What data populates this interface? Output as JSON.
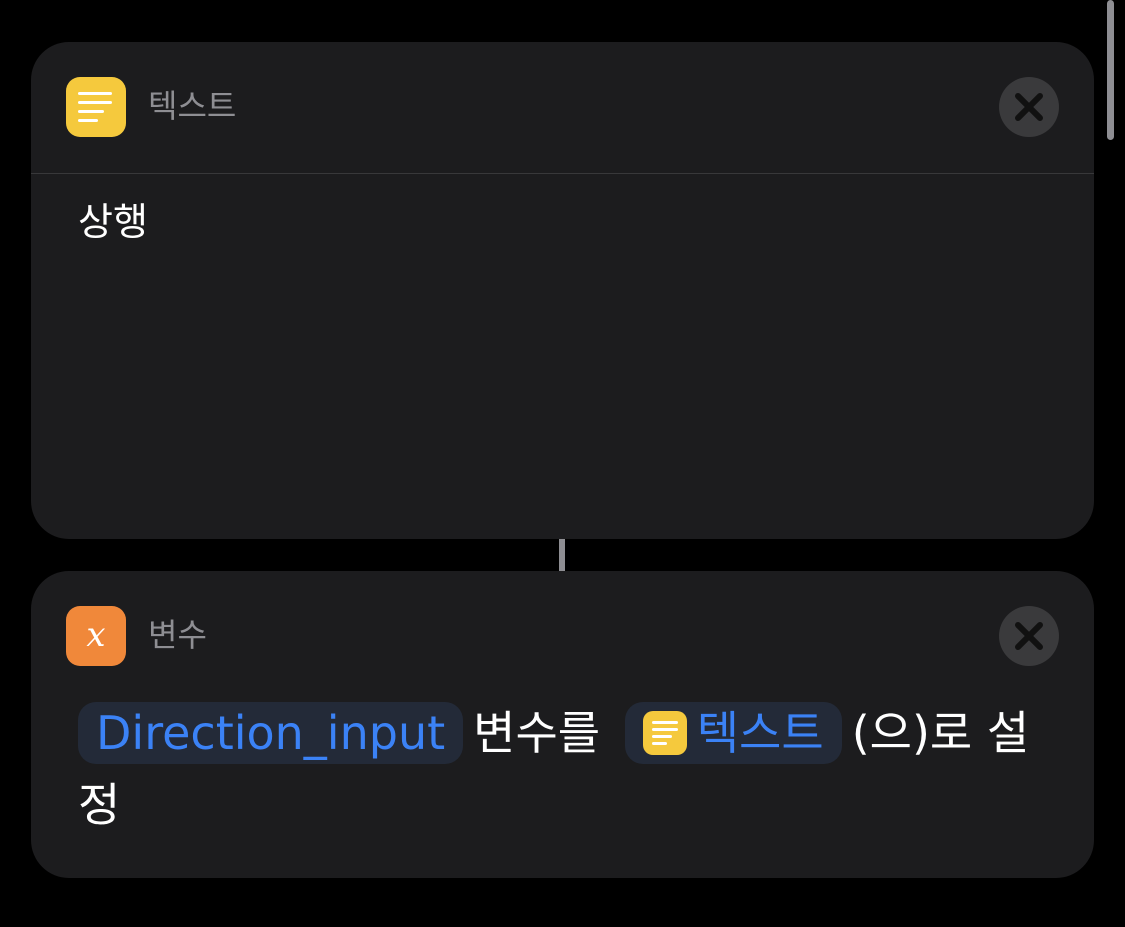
{
  "text_action": {
    "title": "텍스트",
    "icon": "text-lines-icon",
    "icon_color": "#f5c93d",
    "content": "상행",
    "close_icon": "close-icon"
  },
  "variable_action": {
    "title": "변수",
    "icon": "variable-x-icon",
    "icon_glyph": "x",
    "icon_color": "#f0883a",
    "variable_name": "Direction_input",
    "text_middle": "변수를",
    "value_token_label": "텍스트",
    "text_suffix": "(으)로 설정",
    "close_icon": "close-icon"
  },
  "colors": {
    "background": "#000000",
    "card": "#1c1c1e",
    "token_text": "#3b82f6",
    "secondary_text": "#8e8e93"
  }
}
